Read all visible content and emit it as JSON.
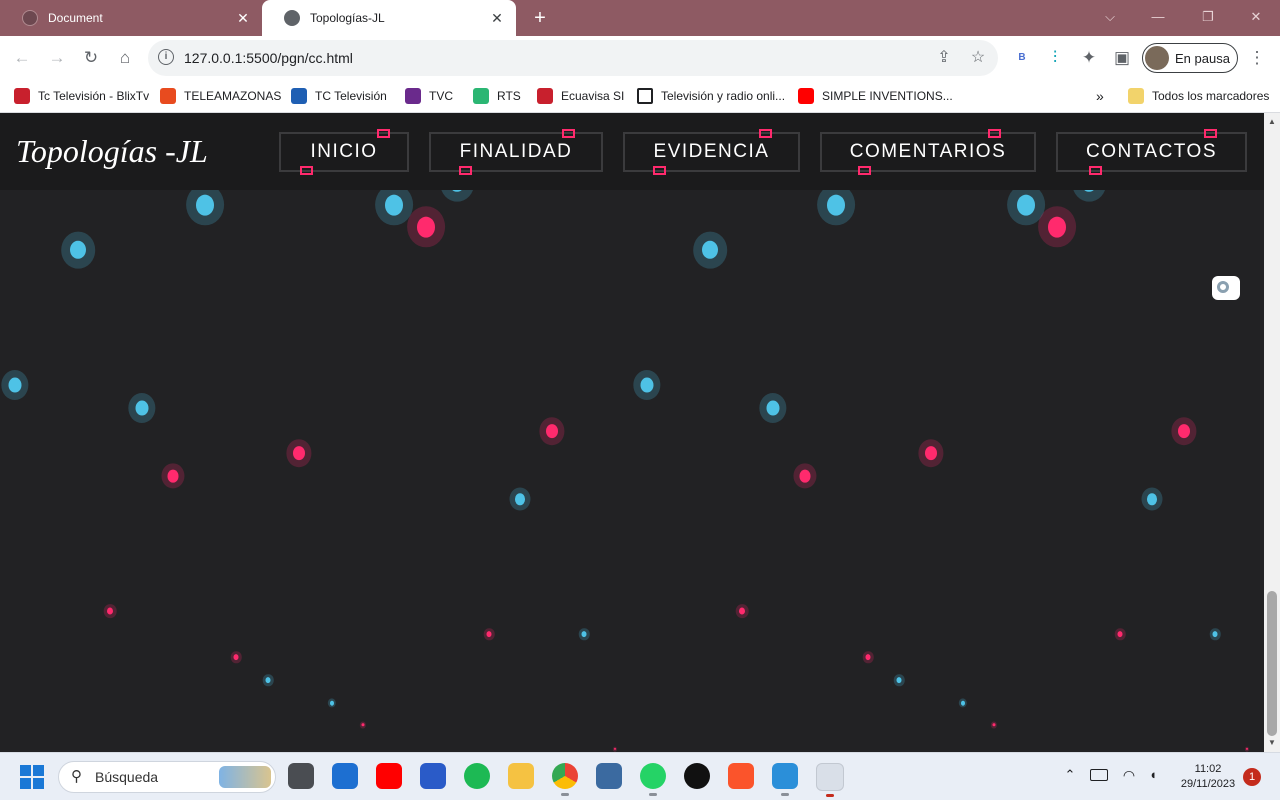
{
  "tabs": [
    {
      "title": "Document",
      "active": false
    },
    {
      "title": "Topologías-JL",
      "active": true
    }
  ],
  "toolbar": {
    "url": "127.0.0.1:5500/pgn/cc.html",
    "profile_label": "En pausa",
    "extension_badge": "B"
  },
  "bookmarks": {
    "items": [
      {
        "label": "Tc Televisión - BlixTv",
        "color": "#c8202d"
      },
      {
        "label": "TELEAMAZONAS",
        "color": "#e84b1f"
      },
      {
        "label": "TC Televisión",
        "color": "#1f5fb3"
      },
      {
        "label": "TVC",
        "color": "#6a2a8c"
      },
      {
        "label": "RTS",
        "color": "#2bb673"
      },
      {
        "label": "Ecuavisa SI",
        "color": "#c8202d"
      },
      {
        "label": "Televisión y radio onli...",
        "color": "#202124"
      },
      {
        "label": "SIMPLE INVENTIONS...",
        "color": "#ff0000"
      }
    ],
    "overflow": "»",
    "all_bookmarks": "Todos los marcadores"
  },
  "page": {
    "site_title": "Topologías -JL",
    "nav": [
      "INICIO",
      "FINALIDAD",
      "EVIDENCIA",
      "COMENTARIOS",
      "CONTACTOS"
    ],
    "colors": {
      "background": "#222224",
      "accent_pink": "#ff2a6d",
      "accent_cyan": "#4ec2e6"
    }
  },
  "taskbar": {
    "search_placeholder": "Búsqueda",
    "time": "11:02",
    "date": "29/11/2023",
    "notification_count": "1"
  }
}
